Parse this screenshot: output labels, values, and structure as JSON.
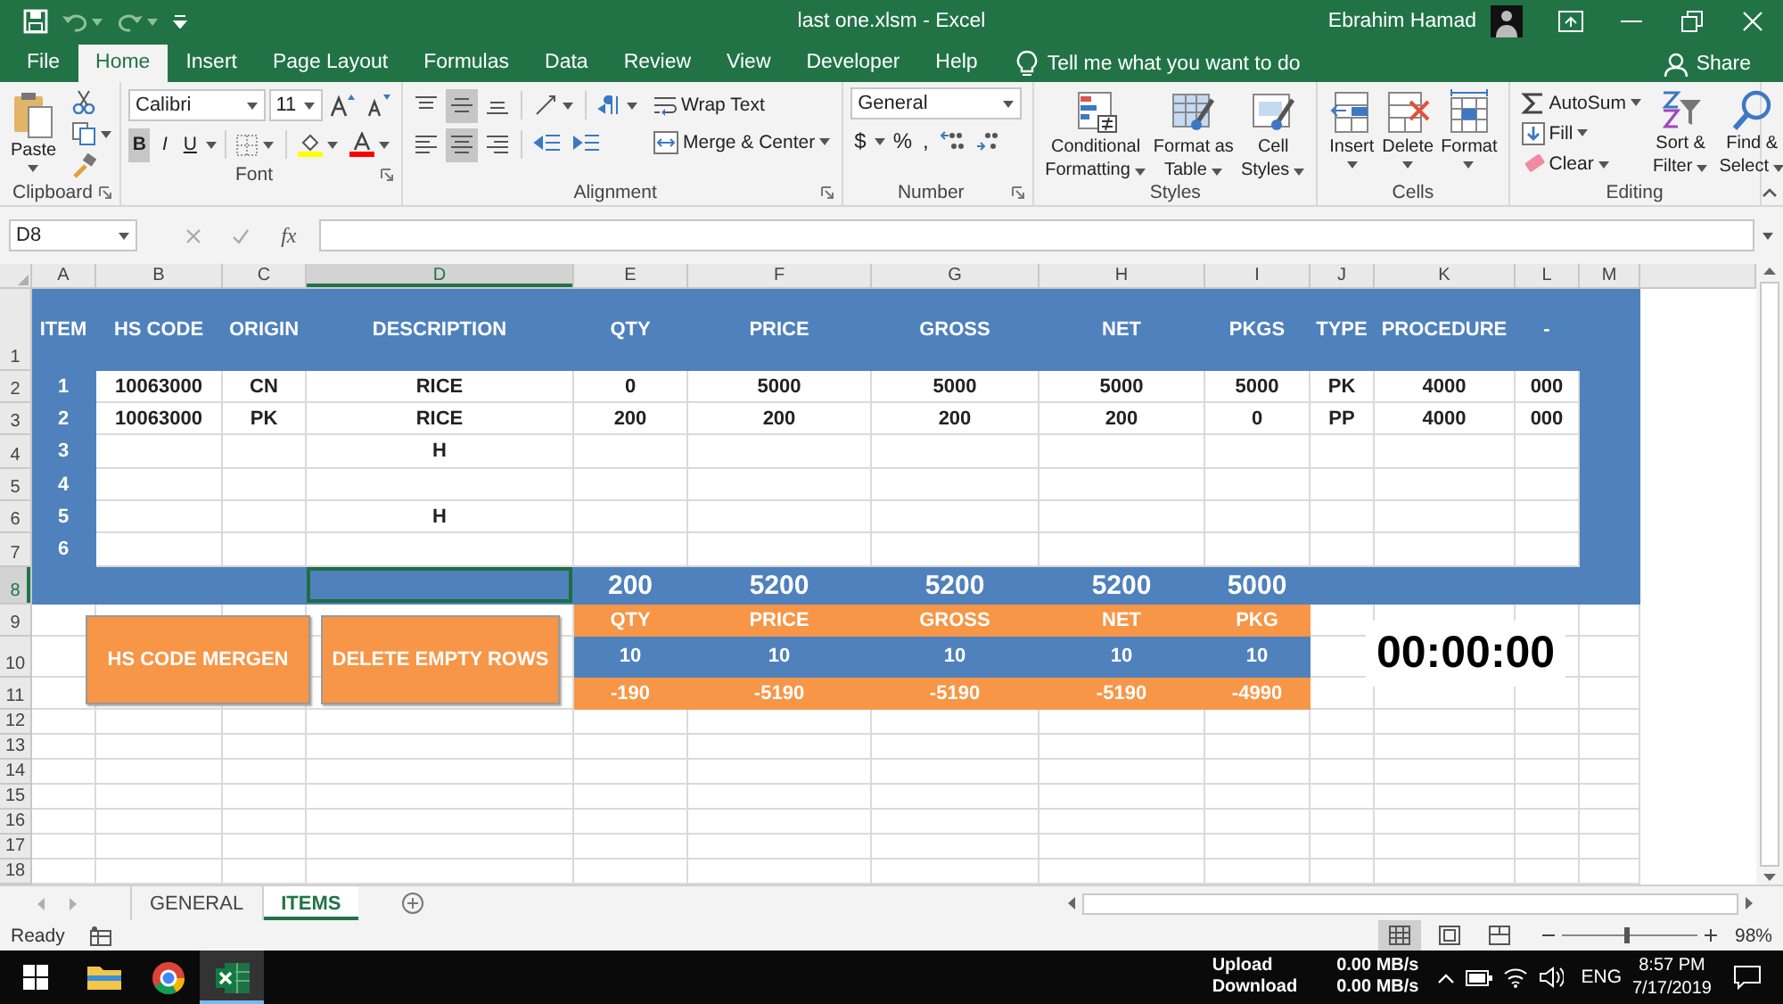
{
  "title_bar": {
    "title": "last one.xlsm  -  Excel",
    "user": "Ebrahim Hamad"
  },
  "ribbon_tabs": [
    {
      "label": "File",
      "selected": false
    },
    {
      "label": "Home",
      "selected": true
    },
    {
      "label": "Insert",
      "selected": false
    },
    {
      "label": "Page Layout",
      "selected": false
    },
    {
      "label": "Formulas",
      "selected": false
    },
    {
      "label": "Data",
      "selected": false
    },
    {
      "label": "Review",
      "selected": false
    },
    {
      "label": "View",
      "selected": false
    },
    {
      "label": "Developer",
      "selected": false
    },
    {
      "label": "Help",
      "selected": false
    }
  ],
  "tell_me": "Tell me what you want to do",
  "share": "Share",
  "ribbon": {
    "clipboard": {
      "label": "Clipboard",
      "paste": "Paste"
    },
    "font": {
      "label": "Font",
      "font_name": "Calibri",
      "font_size": "11",
      "styles": [
        {
          "label": "B",
          "selected": true
        },
        {
          "label": "I",
          "selected": false
        },
        {
          "label": "U",
          "selected": false
        }
      ]
    },
    "alignment": {
      "label": "Alignment",
      "vertical": [
        {
          "kind": "top",
          "selected": false
        },
        {
          "kind": "middle",
          "selected": true
        },
        {
          "kind": "bottom",
          "selected": false
        }
      ],
      "horizontal": [
        {
          "kind": "left",
          "selected": false
        },
        {
          "kind": "center",
          "selected": true
        },
        {
          "kind": "right",
          "selected": false
        }
      ],
      "wrap_text": "Wrap Text",
      "merge": "Merge & Center"
    },
    "number": {
      "label": "Number",
      "format": "General",
      "symbols": [
        "$",
        "%",
        ","
      ]
    },
    "styles": {
      "label": "Styles",
      "buttons": [
        {
          "kind": "conditional",
          "lines": [
            "Conditional",
            "Formatting"
          ]
        },
        {
          "kind": "table",
          "lines": [
            "Format as",
            "Table"
          ]
        },
        {
          "kind": "cell_styles",
          "lines": [
            "Cell",
            "Styles"
          ]
        }
      ]
    },
    "cells": {
      "label": "Cells",
      "buttons": [
        {
          "kind": "insert",
          "label": "Insert"
        },
        {
          "kind": "delete",
          "label": "Delete"
        },
        {
          "kind": "format",
          "label": "Format"
        }
      ]
    },
    "editing": {
      "label": "Editing",
      "autosum": "AutoSum",
      "fill": "Fill",
      "clear": "Clear",
      "buttons": [
        {
          "kind": "sort",
          "lines": [
            "Sort &",
            "Filter"
          ]
        },
        {
          "kind": "find",
          "lines": [
            "Find &",
            "Select"
          ]
        }
      ]
    }
  },
  "formula_bar": {
    "name_box": "D8",
    "function_label": "fx"
  },
  "sheet": {
    "columns": [
      {
        "label": "A",
        "selected": false
      },
      {
        "label": "B",
        "selected": false
      },
      {
        "label": "C",
        "selected": false
      },
      {
        "label": "D",
        "selected": true
      },
      {
        "label": "E",
        "selected": false
      },
      {
        "label": "F",
        "selected": false
      },
      {
        "label": "G",
        "selected": false
      },
      {
        "label": "H",
        "selected": false
      },
      {
        "label": "I",
        "selected": false
      },
      {
        "label": "J",
        "selected": false
      },
      {
        "label": "K",
        "selected": false
      },
      {
        "label": "L",
        "selected": false
      },
      {
        "label": "M",
        "selected": false
      }
    ],
    "rows": [
      {
        "label": "1",
        "selected": false
      },
      {
        "label": "2",
        "selected": false
      },
      {
        "label": "3",
        "selected": false
      },
      {
        "label": "4",
        "selected": false
      },
      {
        "label": "5",
        "selected": false
      },
      {
        "label": "6",
        "selected": false
      },
      {
        "label": "7",
        "selected": false
      },
      {
        "label": "8",
        "selected": true
      },
      {
        "label": "9",
        "selected": false
      },
      {
        "label": "10",
        "selected": false
      },
      {
        "label": "11",
        "selected": false
      },
      {
        "label": "12",
        "selected": false
      },
      {
        "label": "13",
        "selected": false
      },
      {
        "label": "14",
        "selected": false
      },
      {
        "label": "15",
        "selected": false
      },
      {
        "label": "16",
        "selected": false
      },
      {
        "label": "17",
        "selected": false
      },
      {
        "label": "18",
        "selected": false
      }
    ],
    "header": [
      "ITEM",
      "HS CODE",
      "ORIGIN",
      "DESCRIPTION",
      "QTY",
      "PRICE",
      "GROSS",
      "NET",
      "PKGS",
      "TYPE",
      "PROCEDURE",
      "-"
    ],
    "items": [
      {
        "item": "1",
        "hs_code": "10063000",
        "origin": "CN",
        "description": "RICE",
        "qty": "0",
        "price": "5000",
        "gross": "5000",
        "net": "5000",
        "pkgs": "5000",
        "type": "PK",
        "procedure": "4000",
        "extra": "000"
      },
      {
        "item": "2",
        "hs_code": "10063000",
        "origin": "PK",
        "description": "RICE",
        "qty": "200",
        "price": "200",
        "gross": "200",
        "net": "200",
        "pkgs": "0",
        "type": "PP",
        "procedure": "4000",
        "extra": "000"
      },
      {
        "item": "3",
        "description": "H"
      },
      {
        "item": "4"
      },
      {
        "item": "5",
        "description": "H"
      },
      {
        "item": "6"
      }
    ],
    "totals": {
      "qty": "200",
      "price": "5200",
      "gross": "5200",
      "net": "5200",
      "pkgs": "5000"
    },
    "summary": {
      "header": [
        "QTY",
        "PRICE",
        "GROSS",
        "NET",
        "PKG"
      ],
      "rows": [
        [
          "10",
          "10",
          "10",
          "10",
          "10"
        ],
        [
          "-190",
          "-5190",
          "-5190",
          "-5190",
          "-4990"
        ]
      ]
    },
    "buttons": [
      "HS CODE MERGEN",
      "DELETE EMPTY ROWS"
    ],
    "timer": "00:00:00"
  },
  "sheet_tabs": [
    {
      "label": "GENERAL",
      "selected": false
    },
    {
      "label": "ITEMS",
      "selected": true
    }
  ],
  "status_bar": {
    "status": "Ready",
    "views": [
      {
        "kind": "normal",
        "selected": true
      },
      {
        "kind": "page_layout",
        "selected": false
      },
      {
        "kind": "page_break",
        "selected": false
      }
    ],
    "zoom": {
      "level": 0.47,
      "reading": "98%"
    }
  },
  "taskbar": {
    "apps": [
      {
        "kind": "explorer",
        "selected": false
      },
      {
        "kind": "browser",
        "selected": false
      },
      {
        "kind": "excel",
        "selected": true
      }
    ],
    "upload_label": "Upload",
    "download_label": "Download",
    "upload": "0.00 MB/s",
    "download": "0.00 MB/s",
    "language": "ENG",
    "time": "8:57 PM",
    "date": "7/17/2019"
  }
}
